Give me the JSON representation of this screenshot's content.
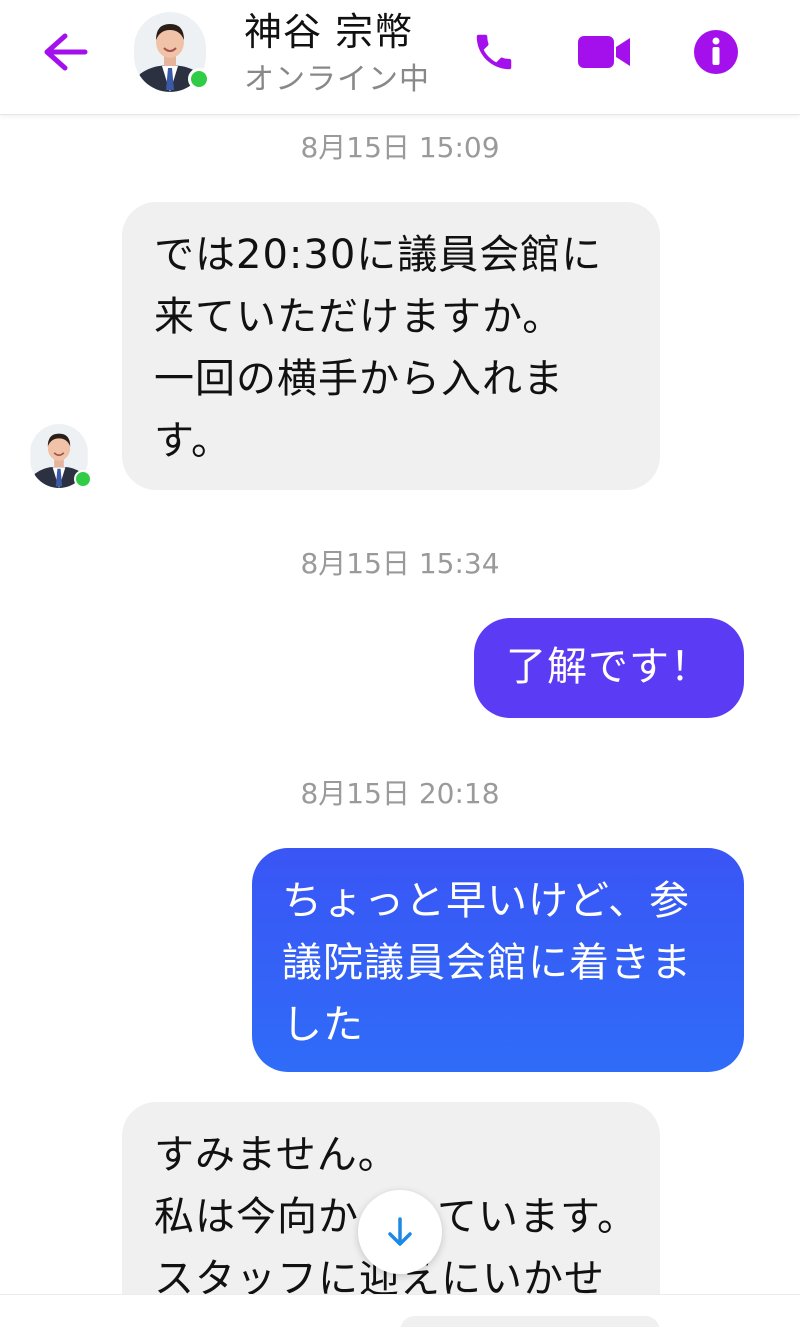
{
  "header": {
    "back_icon": "arrow-left-icon",
    "contact_name": "神谷 宗幣",
    "status": "オンライン中",
    "call_icon": "phone-icon",
    "video_icon": "video-camera-icon",
    "info_icon": "info-icon",
    "accent_color": "#a310ec",
    "online_color": "#31cc46"
  },
  "messages": [
    {
      "type": "timestamp",
      "text": "8月15日 15:09"
    },
    {
      "type": "incoming",
      "lines": [
        "では20:30に議員会館に",
        "来ていただけますか。",
        "一回の横手から入れま",
        "す。"
      ]
    },
    {
      "type": "timestamp",
      "text": "8月15日 15:34"
    },
    {
      "type": "outgoing",
      "lines": [
        "了解です！"
      ],
      "color": "#5b3cf4"
    },
    {
      "type": "timestamp",
      "text": "8月15日 20:18"
    },
    {
      "type": "outgoing",
      "lines": [
        "ちょっと早いけど、参",
        "議院議員会館に着きま",
        "した"
      ],
      "color": "#3567f6"
    },
    {
      "type": "incoming",
      "lines": [
        "すみません。",
        "私は今向か",
        "ています。",
        "スタッフに迎えにいかせ"
      ]
    }
  ],
  "scroll_button": {
    "icon": "arrow-down-icon",
    "color": "#1e88e5"
  }
}
